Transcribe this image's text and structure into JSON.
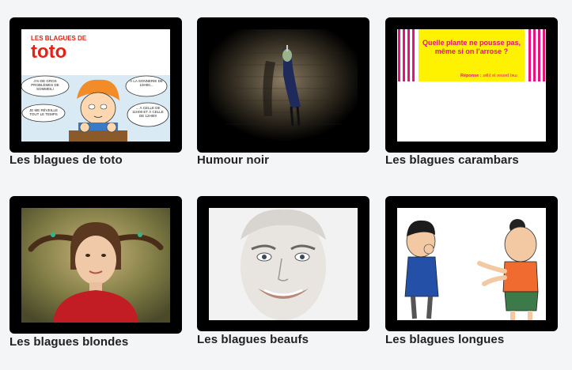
{
  "cards": [
    {
      "title": "Les blagues de toto",
      "logo_line1": "LES BLAGUES DE",
      "logo_line2": "toto",
      "bubbles": [
        "J'AI DE GROS PROBLÈMES DE SOMMEIL!",
        "JE ME RÉVEILLE TOUT LE TEMPS",
        "À LA SONNERIE DE 10H00...",
        "... À CELLE DE 11H00 ET À CELLE DE 12H00!"
      ]
    },
    {
      "title": "Humour noir"
    },
    {
      "title": "Les blagues carambars",
      "riddle": "Quelle plante ne pousse pas, même si on l'arrose ?",
      "answer_label": "Réponse :",
      "answer_text": "ɹǝllıʇ ǝʇ ǝsuǝd ʇǝɯ"
    },
    {
      "title": "Les blagues blondes"
    },
    {
      "title": "Les blagues beaufs"
    },
    {
      "title": "Les blagues longues"
    }
  ],
  "colors": {
    "frame": "#000000",
    "background": "#f4f5f7",
    "logo_red": "#e2231a",
    "candy_pink": "#e6127d",
    "riddle_yellow": "#fff200"
  }
}
